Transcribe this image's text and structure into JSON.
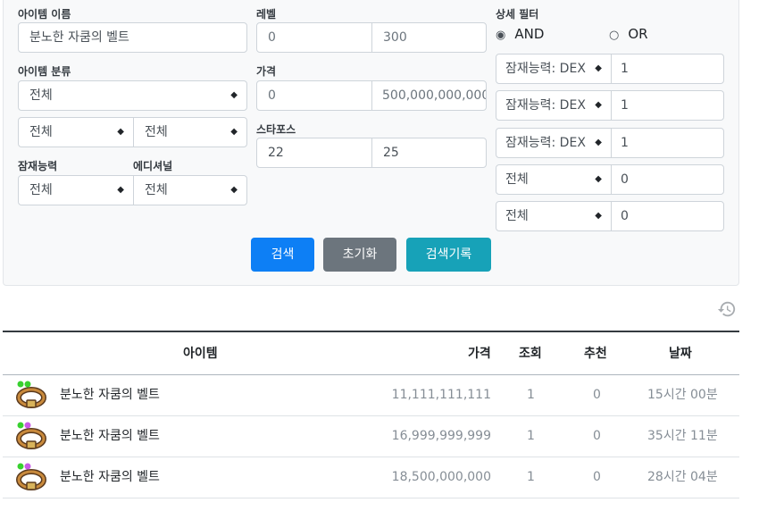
{
  "filters": {
    "item_name_label": "아이템 이름",
    "item_name_value": "분노한 자쿰의 벨트",
    "category_label": "아이템 분류",
    "category_select": "전체",
    "sub_category_1": "전체",
    "sub_category_2": "전체",
    "potential_label": "잠재능력",
    "potential_select": "전체",
    "additional_label": "에디셔널",
    "additional_select": "전체",
    "level_label": "레벨",
    "level_min": "0",
    "level_max": "300",
    "price_label": "가격",
    "price_min": "0",
    "price_max": "500,000,000,000",
    "starforce_label": "스타포스",
    "starforce_min": "22",
    "starforce_max": "25",
    "detail_label": "상세 필터",
    "radio_and": "AND",
    "radio_or": "OR",
    "detail_rows": [
      {
        "option": "잠재능력: DEX % 증가",
        "value": "1"
      },
      {
        "option": "잠재능력: DEX % 증가",
        "value": "1"
      },
      {
        "option": "잠재능력: DEX % 증가",
        "value": "1"
      },
      {
        "option": "전체",
        "value": "0"
      },
      {
        "option": "전체",
        "value": "0"
      }
    ]
  },
  "buttons": {
    "search": "검색",
    "reset": "초기화",
    "history": "검색기록"
  },
  "table": {
    "headers": {
      "item": "아이템",
      "price": "가격",
      "views": "조회",
      "recommend": "추천",
      "date": "날짜"
    },
    "rows": [
      {
        "name": "분노한 자쿰의 벨트",
        "price": "11,111,111,111",
        "views": "1",
        "recommend": "0",
        "date": "15시간 00분",
        "dot1": "#38d12f",
        "dot2": "#38d12f"
      },
      {
        "name": "분노한 자쿰의 벨트",
        "price": "16,999,999,999",
        "views": "1",
        "recommend": "0",
        "date": "35시간 11분",
        "dot1": "#38d12f",
        "dot2": "#c85ae6"
      },
      {
        "name": "분노한 자쿰의 벨트",
        "price": "18,500,000,000",
        "views": "1",
        "recommend": "0",
        "date": "28시간 04분",
        "dot1": "#38d12f",
        "dot2": "#c85ae6"
      }
    ]
  },
  "icons": {
    "select_arrow": "sort-arrows-icon",
    "history": "history-icon",
    "item": "belt-icon"
  },
  "colors": {
    "primary": "#0d7ff5",
    "secondary": "#6c757d",
    "info": "#17a2b8"
  }
}
